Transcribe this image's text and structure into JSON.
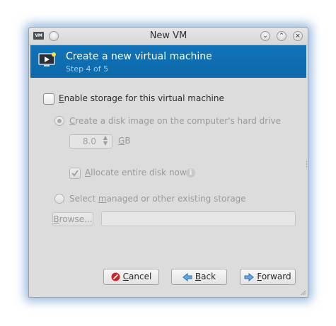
{
  "window": {
    "title": "New VM",
    "app_icon_text": "VM",
    "titlebar_buttons": [
      "chevron-down-icon",
      "chevron-up-icon",
      "close-icon"
    ]
  },
  "banner": {
    "title": "Create a new virtual machine",
    "subtitle": "Step 4 of 5",
    "color": "#0f6eb0"
  },
  "storage": {
    "enable_label": "Enable storage for this virtual machine",
    "enable_checked": false,
    "create_disk_label": "Create a disk image on the computer's hard drive",
    "create_disk_selected": true,
    "disk_size_value": "8.0",
    "disk_size_unit": "GB",
    "allocate_label": "Allocate entire disk now",
    "allocate_checked": true,
    "select_existing_label": "Select managed or other existing storage",
    "select_existing_selected": false,
    "browse_label": "Browse...",
    "path_value": ""
  },
  "buttons": {
    "cancel": "Cancel",
    "back": "Back",
    "forward": "Forward"
  }
}
